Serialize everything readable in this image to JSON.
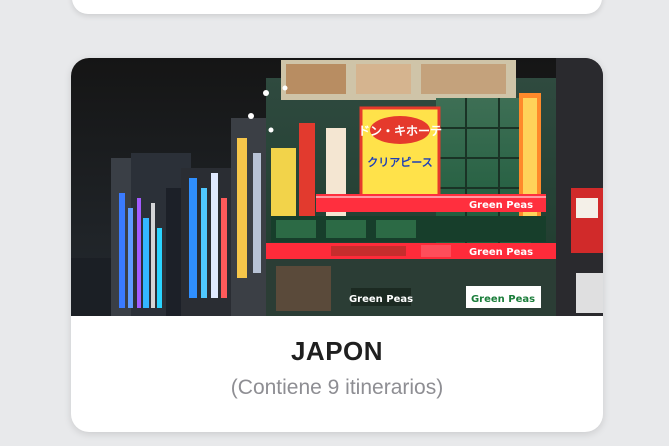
{
  "previous_card": {},
  "destination_card": {
    "title": "JAPON",
    "subtitle": "(Contiene 9 itinerarios)",
    "image": {
      "subject": "neon-city-street-night",
      "signs": {
        "upper_yellow": [
          "ドン・キホーテ",
          "クリアピース"
        ],
        "green_peas_1": "Green Peas",
        "green_peas_2": "Green Peas",
        "green_peas_3": "Green Peas"
      }
    }
  },
  "colors": {
    "background": "#e8e9eb",
    "card": "#ffffff",
    "title": "#1f1f1f",
    "subtitle": "#8e8e93"
  }
}
